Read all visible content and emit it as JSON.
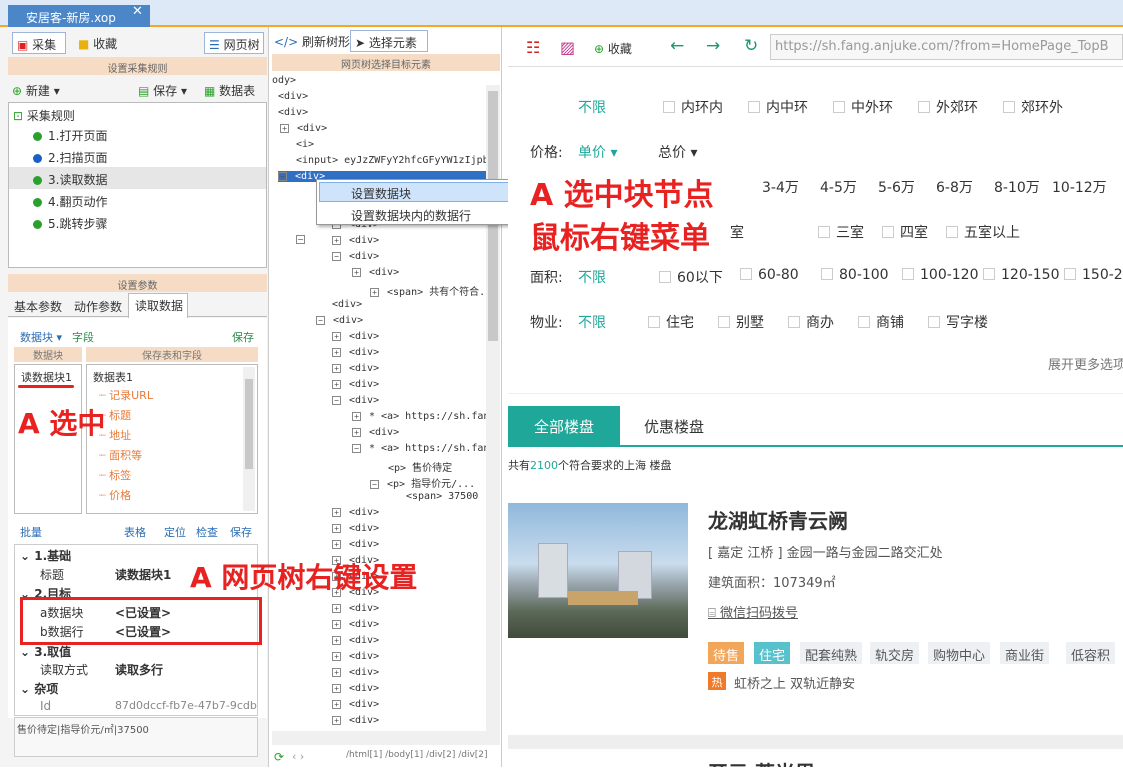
{
  "window": {
    "tab_title": "安居客-新房.xop",
    "close": "✕"
  },
  "left": {
    "toolbar": {
      "collect": "采集",
      "favorite": "收藏",
      "webtree": "网页树"
    },
    "rules_header": "设置采集规则",
    "rule_toolbar": {
      "new": "新建",
      "save": "保存",
      "datatable": "数据表"
    },
    "rules_root": "采集规则",
    "steps": [
      {
        "label": "1.打开页面",
        "color": "#2aa12a"
      },
      {
        "label": "2.扫描页面",
        "color": "#1a5fc8"
      },
      {
        "label": "3.读取数据",
        "color": "#2aa12a"
      },
      {
        "label": "4.翻页动作",
        "color": "#2aa12a"
      },
      {
        "label": "5.跳转步骤",
        "color": "#2aa12a"
      }
    ],
    "params_header": "设置参数",
    "param_tabs": [
      "基本参数",
      "动作参数",
      "读取数据"
    ],
    "block_bar": {
      "block": "数据块",
      "field": "字段",
      "save": "保存"
    },
    "block_col": "数据块",
    "table_col": "保存表和字段",
    "block_item": "读数据块1",
    "table_name": "数据表1",
    "fields": [
      "记录URL",
      "标题",
      "地址",
      "面积等",
      "标签",
      "价格"
    ],
    "bottom_bar": {
      "batch": "批量",
      "table": "表格",
      "locate": "定位",
      "check": "检查",
      "save": "保存"
    },
    "props": {
      "g1": "1.基础",
      "title_k": "标题",
      "title_v": "读数据块1",
      "g2": "2.目标",
      "a_k": "a数据块",
      "a_v": "<已设置>",
      "b_k": "b数据行",
      "b_v": "<已设置>",
      "g3": "3.取值",
      "mode_k": "读取方式",
      "mode_v": "读取多行",
      "g4": "杂项",
      "id_k": "Id",
      "id_v": "87d0dccf-fb7e-47b7-9cdb"
    },
    "result": "售价待定|指导价元/㎡|37500"
  },
  "mid": {
    "refresh": "刷新树形",
    "select": "选择元素",
    "header": "网页树选择目标元素",
    "nodes_top": [
      "ody>",
      "<div>",
      "<div>",
      "<div>",
      "<i>",
      "<input>  eyJzZWFyY2hfcGFyYW1zIjpb",
      "<div>"
    ],
    "menu": [
      "设置数据块",
      "设置数据块内的数据行"
    ],
    "nodes": [
      "<div>",
      "<div>",
      "<div>",
      "<div>",
      "<span> 共有个符合...",
      "<div>",
      "<div>",
      "<div>",
      "<div>",
      "<div>",
      "<div>",
      "<div>",
      "* <a>  https://sh.fang.a",
      "<div>",
      "* <a>  https://sh.fang.a",
      "<p> 售价待定",
      "<p> 指导价元/...",
      "<span> 37500",
      "<div>",
      "<div>",
      "<div>",
      "<div>",
      "<div>",
      "<div>",
      "<div>",
      "<div>",
      "<div>",
      "<div>",
      "<div>",
      "<div>",
      "<div>",
      "<div>",
      "<div>"
    ],
    "path": "/html[1]  /body[1]  /div[2]  /div[2]"
  },
  "right": {
    "favorite": "收藏",
    "url": "https://sh.fang.anjuke.com/?from=HomePage_TopB",
    "ring_options": [
      "不限",
      "内环内",
      "内中环",
      "中外环",
      "外郊环",
      "郊环外"
    ],
    "price_label": "价格:",
    "unit_price": "单价",
    "total_price": "总价",
    "price_options": [
      "3-4万",
      "4-5万",
      "5-6万",
      "6-8万",
      "8-10万",
      "10-12万"
    ],
    "room_options": [
      "室",
      "三室",
      "四室",
      "五室以上"
    ],
    "area_label": "面积:",
    "area_options": [
      "不限",
      "60以下",
      "60-80",
      "80-100",
      "100-120",
      "120-150",
      "150-2"
    ],
    "type_label": "物业:",
    "type_options": [
      "不限",
      "住宅",
      "别墅",
      "商办",
      "商铺",
      "写字楼"
    ],
    "more": "展开更多选项",
    "tab_all": "全部楼盘",
    "tab_offer": "优惠楼盘",
    "count_pre": "共有",
    "count": "2100",
    "count_post": "个符合要求的上海 楼盘",
    "listing": {
      "name": "龙湖虹桥青云阙",
      "addr": "[ 嘉定 江桥 ] 金园一路与金园二路交汇处",
      "area": "建筑面积：107349㎡",
      "phone": "微信扫码拨号",
      "tags": [
        "待售",
        "住宅",
        "配套纯熟",
        "轨交房",
        "购物中心",
        "商业街",
        "低容积"
      ],
      "hot": "热",
      "slogan": "虹桥之上 双轨近静安"
    },
    "next_name": "开元 菩光里"
  },
  "annotations": {
    "a1": "A 选中块节点",
    "a2": "鼠标右键菜单",
    "a3": "A 选中",
    "a4": "A 网页树右键设置"
  },
  "colors": {
    "accent": "#1fa89a",
    "tab_blue": "#4a86c8",
    "red": "#e82121",
    "orange_tag": "#f2a65a",
    "teal_tag": "#57c2cc"
  }
}
